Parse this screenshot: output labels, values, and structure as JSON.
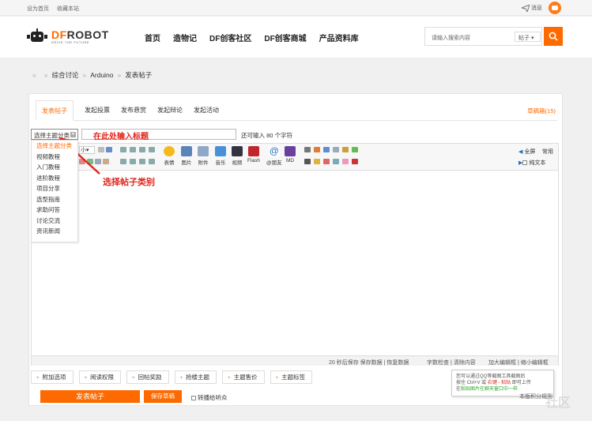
{
  "topbar": {
    "set_home": "设为首页",
    "bookmark": "收藏本站",
    "messages": "消息"
  },
  "brand": {
    "logo_df": "DF",
    "logo_robot": "ROBOT",
    "tagline": "DRIVE THE FUTURE"
  },
  "nav": [
    "首页",
    "造物记",
    "DF创客社区",
    "DF创客商城",
    "产品资料库"
  ],
  "search": {
    "placeholder": "请输入搜索内容",
    "scope": "帖子",
    "accent": "#ff6a00"
  },
  "breadcrumb": {
    "sep": "»",
    "items": [
      "综合讨论",
      "Arduino",
      "发表帖子"
    ]
  },
  "tabs": {
    "items": [
      "发表帖子",
      "发起投票",
      "发布悬赏",
      "发起辩论",
      "发起活动"
    ],
    "drafts": "草稿箱(15)"
  },
  "form": {
    "type_select": "选择主题分类",
    "title_annotation": "在此处输入标题",
    "char_limit": "还可输入 80 个字符",
    "type_annotation": "选择帖子类别",
    "categories": [
      "选择主题分类",
      "视频教程",
      "入门教程",
      "进阶教程",
      "项目分享",
      "选型指南",
      "求助问答",
      "讨论交流",
      "资讯新闻"
    ]
  },
  "editor": {
    "font_size": "小",
    "tools": [
      "表情",
      "图片",
      "附件",
      "音乐",
      "视频",
      "Flash",
      "@朋友",
      "MD"
    ],
    "fullscreen": "全屏",
    "common": "常用",
    "plain_text": "纯文本",
    "tip_line1": "您可以通过QQ等截图工具截图后",
    "tip_line2_a": "按住 Ctrl+V 或",
    "tip_line2_b": "右键 - 粘贴",
    "tip_line2_c": "即可上传",
    "tip_line3_a": "在",
    "tip_line3_b": "粘贴图片在聊天窗口中一样",
    "status": {
      "autosave": "20 秒后保存 保存数据 | 恢复数据",
      "check": "字数检查 | 清除内容",
      "resize": "加大编辑框 | 缩小编辑框"
    }
  },
  "options": [
    "附加选项",
    "阅读权限",
    "回帖奖励",
    "抢楼主题",
    "主题售价",
    "主题标签"
  ],
  "actions": {
    "submit": "发表帖子",
    "save_draft": "保存草稿",
    "listen": "转播给听众",
    "right_note": "本版积分规则"
  },
  "watermark": "社区"
}
